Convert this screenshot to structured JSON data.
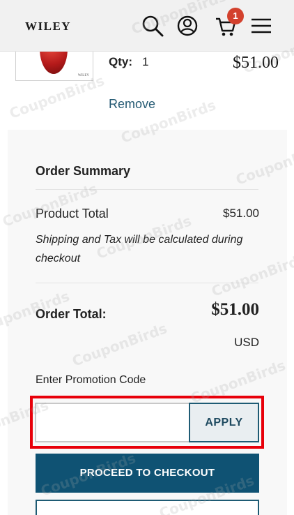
{
  "header": {
    "logo": "WILEY",
    "cart_count": "1",
    "icons": [
      "search-icon",
      "user-icon",
      "cart-icon",
      "menu-icon"
    ]
  },
  "cart_item": {
    "qty_label": "Qty:",
    "qty_value": "1",
    "price": "$51.00",
    "remove_label": "Remove",
    "thumb_caption": "WILEY"
  },
  "summary": {
    "title": "Order Summary",
    "product_total_label": "Product Total",
    "product_total_value": "$51.00",
    "shipping_note": "Shipping and Tax will be calculated during checkout",
    "order_total_label": "Order Total:",
    "order_total_value": "$51.00",
    "currency": "USD"
  },
  "promo": {
    "label": "Enter Promotion Code",
    "input_value": "",
    "placeholder": "",
    "apply_label": "APPLY"
  },
  "actions": {
    "checkout_label": "PROCEED TO CHECKOUT"
  },
  "watermark": "CouponBirds",
  "colors": {
    "primary": "#0f5273",
    "badge": "#d3412d",
    "highlight": "#e8000a",
    "link": "#245a73"
  }
}
